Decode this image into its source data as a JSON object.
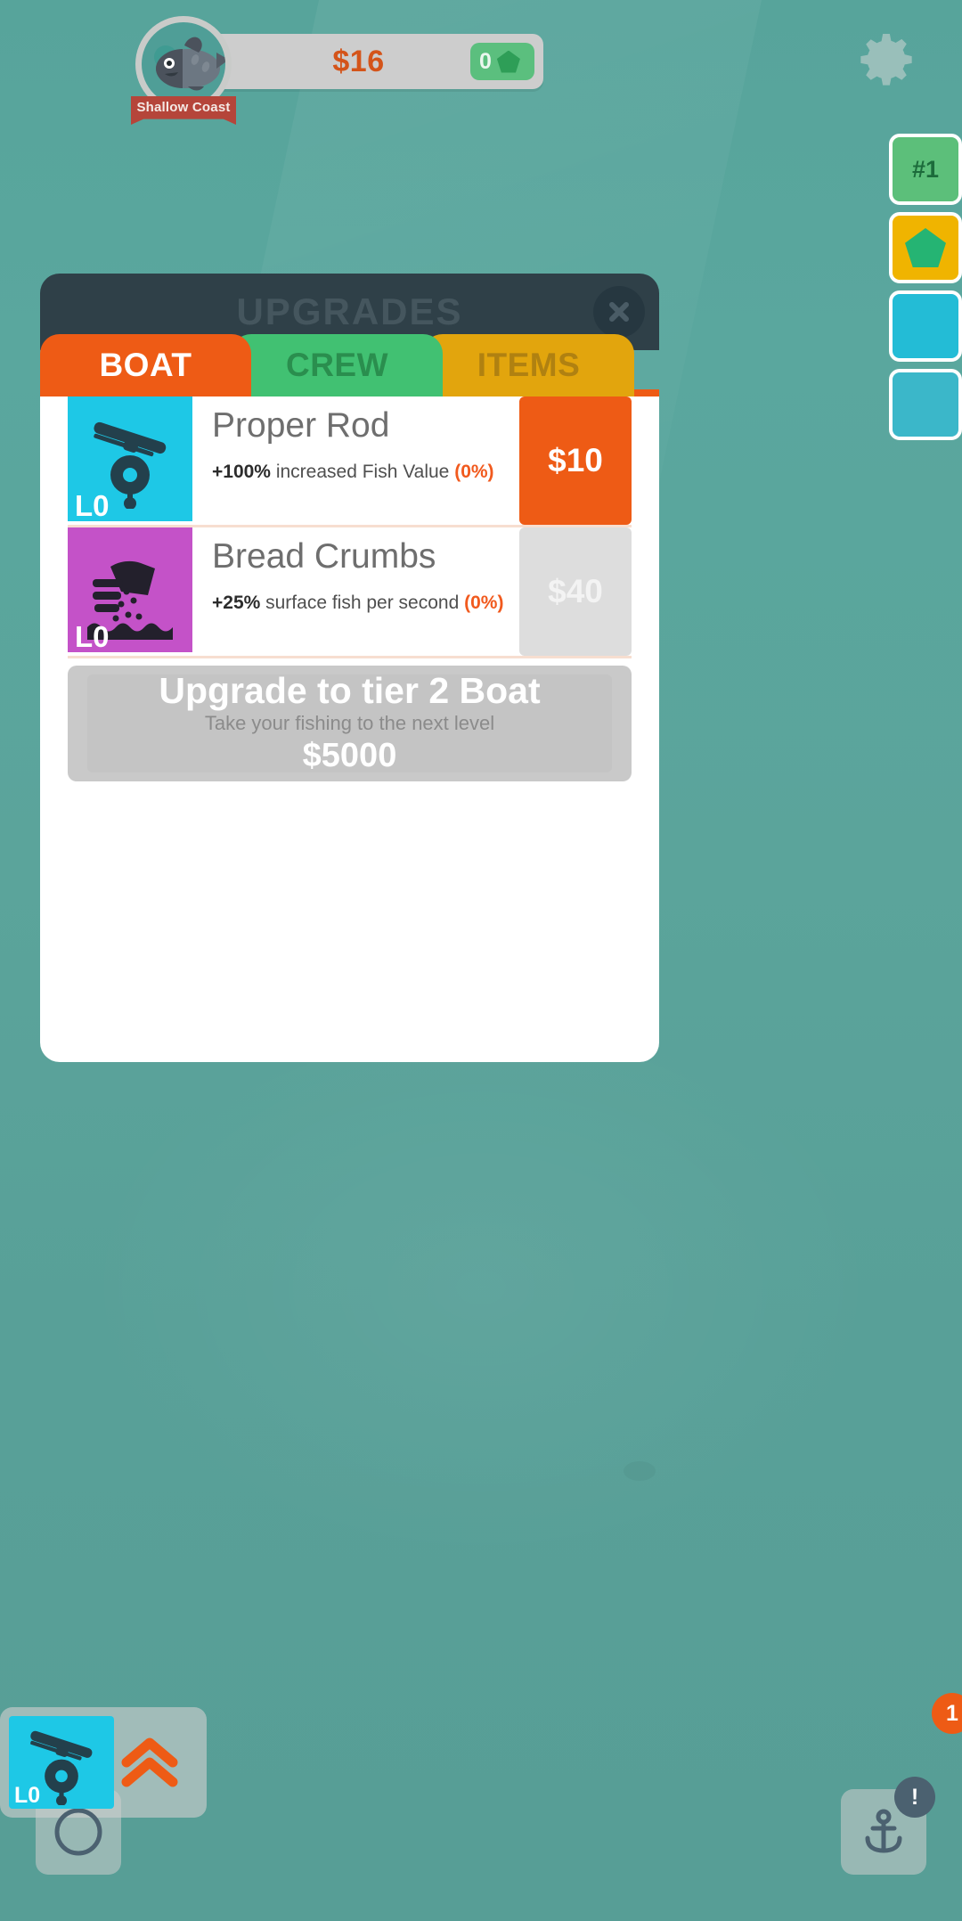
{
  "topbar": {
    "money": "$16",
    "gems": "0",
    "zone_name": "Shallow Coast",
    "gear_icon": "gear-icon",
    "fish_icon": "fish-portrait-icon",
    "gem_icon": "gem-icon"
  },
  "rail": {
    "rank_label": "#1",
    "gem_icon": "gem-icon"
  },
  "modal": {
    "title": "UPGRADES",
    "close_icon": "close-icon",
    "tabs": [
      {
        "label": "BOAT",
        "color": "#ee5b15",
        "active": true
      },
      {
        "label": "CREW",
        "color": "#41c172",
        "active": false
      },
      {
        "label": "ITEMS",
        "color": "#e2a50d",
        "active": false
      }
    ],
    "upgrades": [
      {
        "name": "Proper Rod",
        "level": "L0",
        "bonus": "+100%",
        "desc": " increased Fish Value ",
        "progress": "(0%)",
        "price": "$10",
        "affordable": true,
        "icon": "fishing-rod-icon",
        "icon_color": "#1ec8e6"
      },
      {
        "name": "Bread Crumbs",
        "level": "L0",
        "bonus": "+25%",
        "desc": " surface fish per second ",
        "progress": "(0%)",
        "price": "$40",
        "affordable": false,
        "icon": "hand-crumbs-icon",
        "icon_color": "#c452c8"
      }
    ],
    "tier_banner": {
      "title": "Upgrade to tier 2 Boat",
      "subtitle": "Take your fishing to the next level",
      "price": "$5000"
    }
  },
  "bottom": {
    "compass_icon": "compass-icon",
    "anchor_icon": "anchor-icon",
    "rod_icon": "fishing-rod-icon",
    "rod_level": "L0",
    "rod_badge": "1",
    "anchor_badge": "!",
    "upgrade_chevrons_icon": "double-chevron-up-icon"
  }
}
